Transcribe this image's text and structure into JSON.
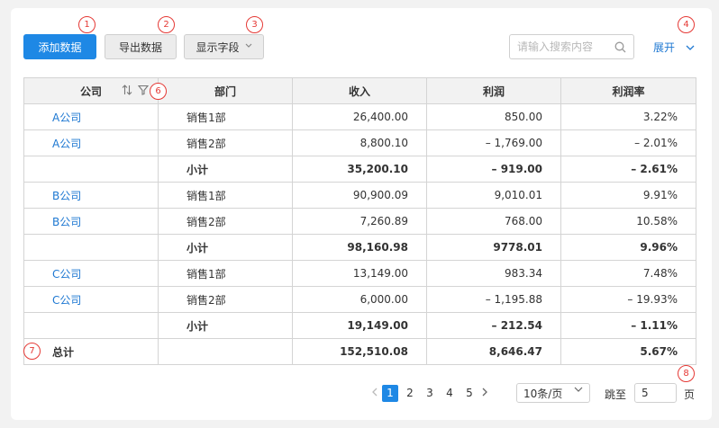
{
  "toolbar": {
    "add_label": "添加数据",
    "export_label": "导出数据",
    "fields_label": "显示字段",
    "search_placeholder": "请输入搜索内容",
    "expand_label": "展开"
  },
  "markers": [
    "1",
    "2",
    "3",
    "4",
    "6",
    "7",
    "8"
  ],
  "table": {
    "headers": [
      "公司",
      "部门",
      "收入",
      "利润",
      "利润率"
    ],
    "rows": [
      {
        "company": "A公司",
        "dept": "销售1部",
        "income": "26,400.00",
        "profit": "850.00",
        "rate": "3.22%",
        "type": "data"
      },
      {
        "company": "A公司",
        "dept": "销售2部",
        "income": "8,800.10",
        "profit": "– 1,769.00",
        "rate": "– 2.01%",
        "type": "data"
      },
      {
        "company": "",
        "dept": "小计",
        "income": "35,200.10",
        "profit": "– 919.00",
        "rate": "– 2.61%",
        "type": "sub"
      },
      {
        "company": "B公司",
        "dept": "销售1部",
        "income": "90,900.09",
        "profit": "9,010.01",
        "rate": "9.91%",
        "type": "data"
      },
      {
        "company": "B公司",
        "dept": "销售2部",
        "income": "7,260.89",
        "profit": "768.00",
        "rate": "10.58%",
        "type": "data"
      },
      {
        "company": "",
        "dept": "小计",
        "income": "98,160.98",
        "profit": "9778.01",
        "rate": "9.96%",
        "type": "sub"
      },
      {
        "company": "C公司",
        "dept": "销售1部",
        "income": "13,149.00",
        "profit": "983.34",
        "rate": "7.48%",
        "type": "data"
      },
      {
        "company": "C公司",
        "dept": "销售2部",
        "income": "6,000.00",
        "profit": "– 1,195.88",
        "rate": "– 19.93%",
        "type": "data"
      },
      {
        "company": "",
        "dept": "小计",
        "income": "19,149.00",
        "profit": "– 212.54",
        "rate": "– 1.11%",
        "type": "sub"
      }
    ],
    "total": {
      "label": "总计",
      "income": "152,510.08",
      "profit": "8,646.47",
      "rate": "5.67%"
    }
  },
  "pagination": {
    "pages": [
      "1",
      "2",
      "3",
      "4",
      "5"
    ],
    "current": "1",
    "page_size": "10条/页",
    "jump_label": "跳至",
    "jump_value": "5",
    "page_unit": "页"
  },
  "colors": {
    "primary": "#1e88e5",
    "link": "#1e78d2",
    "marker": "#e53935"
  },
  "icons": [
    "search-icon",
    "sort-icon",
    "filter-icon",
    "chevron-down-icon",
    "chevron-left-icon",
    "chevron-right-icon"
  ]
}
